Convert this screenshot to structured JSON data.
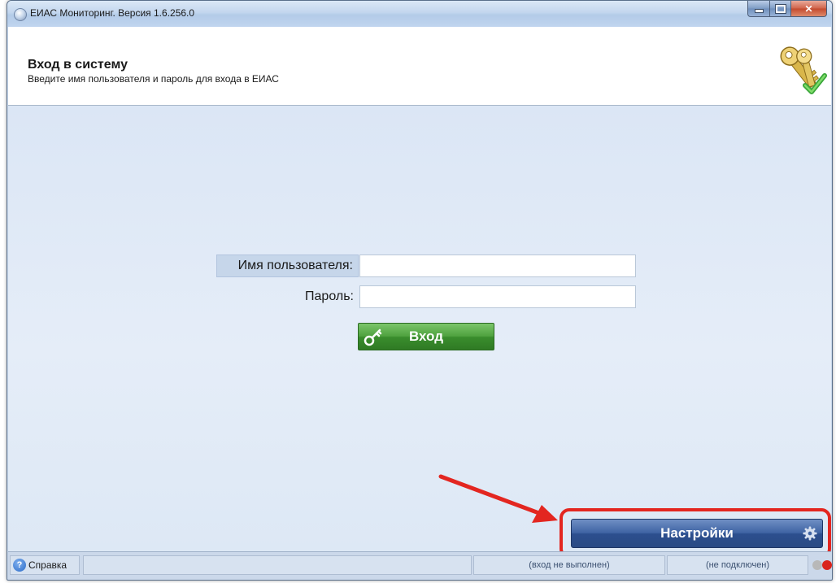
{
  "window": {
    "title": "ЕИАС Мониторинг. Версия 1.6.256.0",
    "controls": {
      "minimize": "minimize",
      "maximize": "maximize",
      "close": "x"
    }
  },
  "header": {
    "title": "Вход в систему",
    "subtitle": "Введите имя пользователя и пароль для входа в ЕИАС",
    "icon": "keys-check-icon"
  },
  "login_form": {
    "username_label": "Имя пользователя:",
    "username_value": "",
    "password_label": "Пароль:",
    "password_value": "",
    "login_button_label": "Вход",
    "login_button_icon": "key-icon"
  },
  "settings": {
    "button_label": "Настройки",
    "icon": "gear-icon"
  },
  "annotation": {
    "arrow_color": "#e32620",
    "highlight_color": "#e32620"
  },
  "statusbar": {
    "help_label": "Справка",
    "login_status": "(вход не выполнен)",
    "connection_status": "(не подключен)",
    "indicator_colors": [
      "#b8b8b8",
      "#d9241c"
    ]
  },
  "colors": {
    "main_bg": "#e0e9f6",
    "login_button": "#3f9a32",
    "settings_button": "#35599a"
  }
}
